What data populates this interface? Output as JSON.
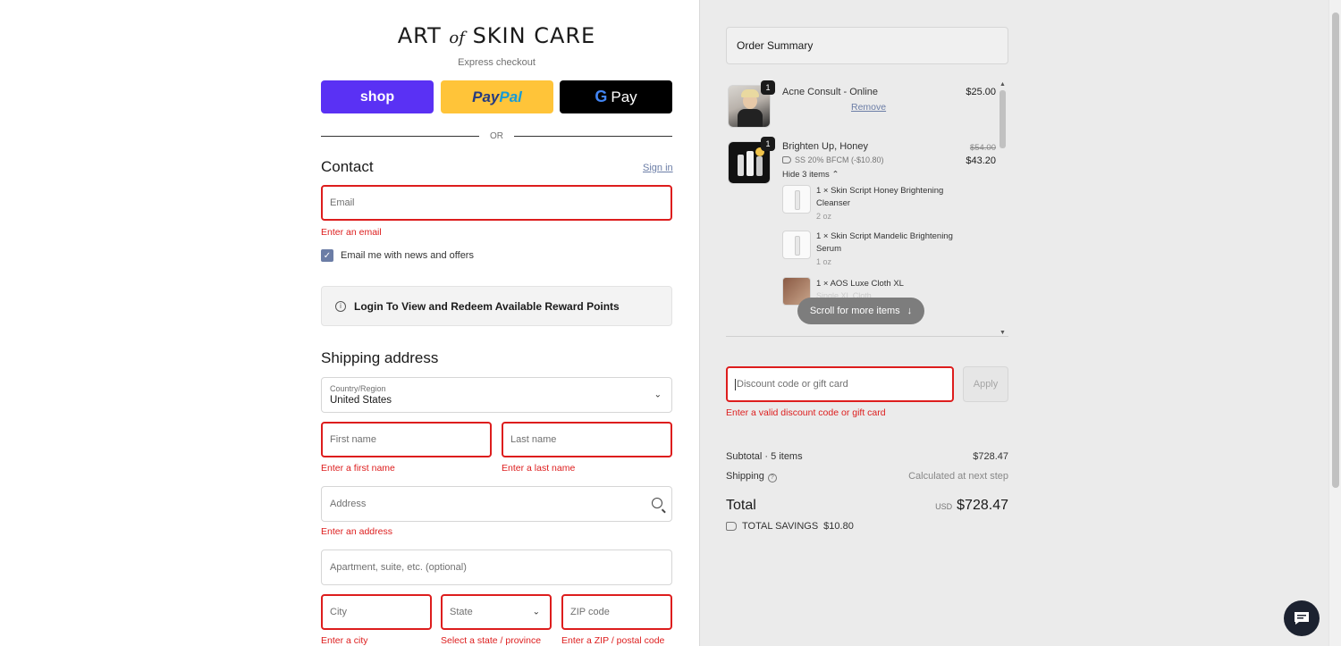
{
  "brand": {
    "art": "ART",
    "of": "of",
    "skin_care": "SKIN CARE"
  },
  "express_checkout": "Express checkout",
  "payment_buttons": {
    "shop": "shop",
    "paypal_a": "Pay",
    "paypal_b": "Pal",
    "gpay_g": "G",
    "gpay_pay": "Pay"
  },
  "or": "OR",
  "contact": {
    "heading": "Contact",
    "sign_in": "Sign in",
    "email_placeholder": "Email",
    "email_error": "Enter an email",
    "newsletter_label": "Email me with news and offers"
  },
  "reward": {
    "text": "Login To View and Redeem Available Reward Points"
  },
  "shipping": {
    "heading": "Shipping address",
    "country_label": "Country/Region",
    "country_value": "United States",
    "first_name": "First name",
    "first_name_error": "Enter a first name",
    "last_name": "Last name",
    "last_name_error": "Enter a last name",
    "address": "Address",
    "address_error": "Enter an address",
    "apartment": "Apartment, suite, etc. (optional)",
    "city": "City",
    "city_error": "Enter a city",
    "state": "State",
    "state_error": "Select a state / province",
    "zip": "ZIP code",
    "zip_error": "Enter a ZIP / postal code"
  },
  "order_summary": {
    "title": "Order Summary",
    "items": [
      {
        "qty": "1",
        "name": "Acne Consult - Online",
        "price": "$25.00",
        "remove": "Remove"
      },
      {
        "qty": "1",
        "name": "Brighten Up, Honey",
        "original_price": "$54.00",
        "price": "$43.20",
        "discount": "SS 20% BFCM (-$10.80)",
        "hide_label": "Hide 3 items"
      }
    ],
    "sub_items": [
      {
        "name": "1 × Skin Script Honey Brightening Cleanser",
        "size": "2 oz"
      },
      {
        "name": "1 × Skin Script Mandelic Brightening Serum",
        "size": "1 oz"
      },
      {
        "name": "1 × AOS Luxe Cloth XL",
        "size": "Single XL Cloth"
      }
    ],
    "scroll_more": "Scroll for more items",
    "discount_placeholder": "Discount code or gift card",
    "apply": "Apply",
    "discount_error": "Enter a valid discount code or gift card",
    "subtotal_label": "Subtotal · 5 items",
    "subtotal": "$728.47",
    "shipping_label": "Shipping",
    "shipping_value": "Calculated at next step",
    "total_label": "Total",
    "currency": "USD",
    "total": "$728.47",
    "savings_label": "TOTAL SAVINGS",
    "savings": "$10.80"
  },
  "colors": {
    "error": "#dd1d1d",
    "accent": "#6b7da6",
    "shop": "#5a31f4",
    "paypal": "#ffc439"
  }
}
